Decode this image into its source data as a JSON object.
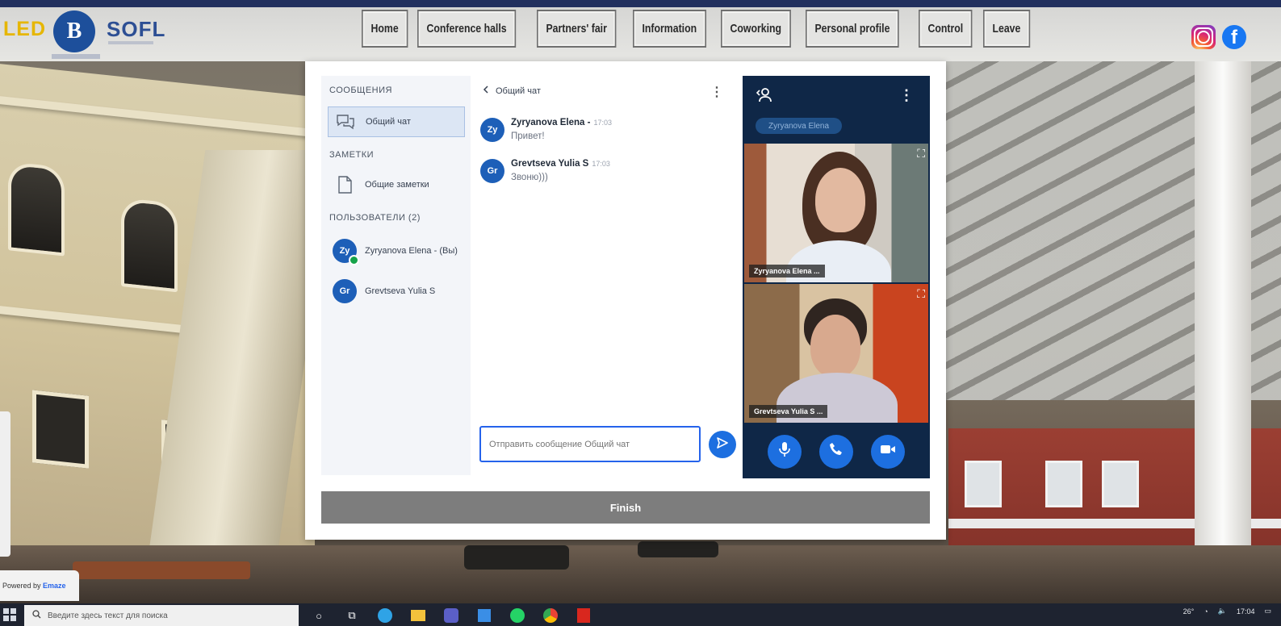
{
  "brand": {
    "led": "LED",
    "hse": "B",
    "sofl": "SOFL"
  },
  "nav": [
    {
      "id": "home",
      "label": "Home"
    },
    {
      "id": "conference-halls",
      "label": "Conference halls"
    },
    {
      "id": "partners-fair",
      "label": "Partners' fair"
    },
    {
      "id": "information",
      "label": "Information"
    },
    {
      "id": "coworking",
      "label": "Coworking"
    },
    {
      "id": "personal-profile",
      "label": "Personal profile"
    },
    {
      "id": "control",
      "label": "Control"
    },
    {
      "id": "leave",
      "label": "Leave"
    }
  ],
  "social": {
    "instagram": "instagram-icon",
    "facebook": "f"
  },
  "sidebar": {
    "messages_title": "СООБЩЕНИЯ",
    "general_chat": "Общий чат",
    "notes_title": "ЗАМЕТКИ",
    "shared_notes": "Общие заметки",
    "users_title": "ПОЛЬЗОВАТЕЛИ (2)",
    "users": [
      {
        "initials": "Zy",
        "name": "Zyryanova Elena - (Вы)",
        "online": true
      },
      {
        "initials": "Gr",
        "name": "Grevtseva Yulia S",
        "online": false
      }
    ]
  },
  "chat": {
    "header": "Общий чат",
    "kebab": "⋮",
    "messages": [
      {
        "initials": "Zy",
        "author": "Zyryanova Elena -",
        "time": "17:03",
        "text": "Привет!"
      },
      {
        "initials": "Gr",
        "author": "Grevtseva Yulia S",
        "time": "17:03",
        "text": "Звоню)))"
      }
    ],
    "input_placeholder": "Отправить сообщение Общий чат"
  },
  "video": {
    "presenter_tag": "Zyryanova Elena",
    "tiles": [
      {
        "label": "Zyryanova Elena ..."
      },
      {
        "label": "Grevtseva Yulia S ..."
      }
    ],
    "controls": [
      "microphone-icon",
      "phone-icon",
      "camera-icon"
    ]
  },
  "finish_label": "Finish",
  "powered": {
    "prefix": "Powered by",
    "brand": "Emaze"
  },
  "taskbar": {
    "search_placeholder": "Введите здесь текст для поиска",
    "temperature": "26°",
    "time": "17:04"
  },
  "colors": {
    "accent": "#1d6fe0",
    "brand_navy": "#22305e",
    "video_bg": "#0f2747",
    "finish": "#7d7d7d"
  }
}
